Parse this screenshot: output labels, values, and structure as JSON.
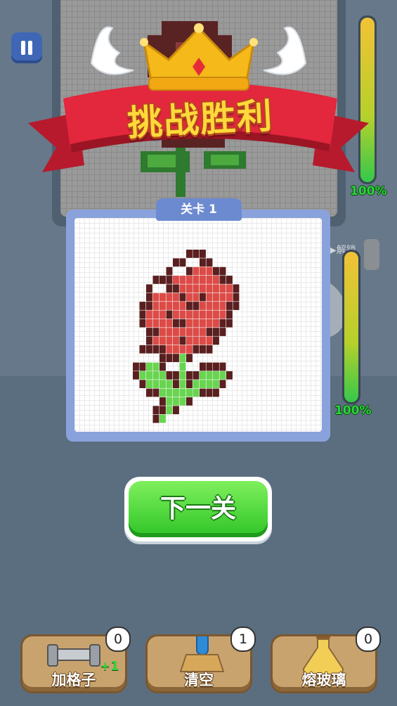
{
  "banner": {
    "title": "挑战胜利"
  },
  "level": {
    "label": "关卡 1"
  },
  "top_progress": {
    "percent_text": "100%",
    "fill": 1.0
  },
  "card_progress": {
    "percent_text": "100%",
    "fill": 1.0
  },
  "side_machine": {
    "label": "解锁"
  },
  "next_button": {
    "label": "下一关"
  },
  "powerups": [
    {
      "label": "加格子",
      "count": "0",
      "bonus": "+1",
      "icon": "pipe-icon"
    },
    {
      "label": "清空",
      "count": "1",
      "icon": "brush-icon"
    },
    {
      "label": "熔玻璃",
      "count": "0",
      "icon": "potion-icon"
    }
  ],
  "colors": {
    "rose_red": "#dc4b47",
    "rose_dark": "#5a1f1f",
    "leaf_green": "#68d450",
    "accent_green": "#2bd33e",
    "banner_red": "#e3273c",
    "crown_gold": "#f5b91a"
  }
}
